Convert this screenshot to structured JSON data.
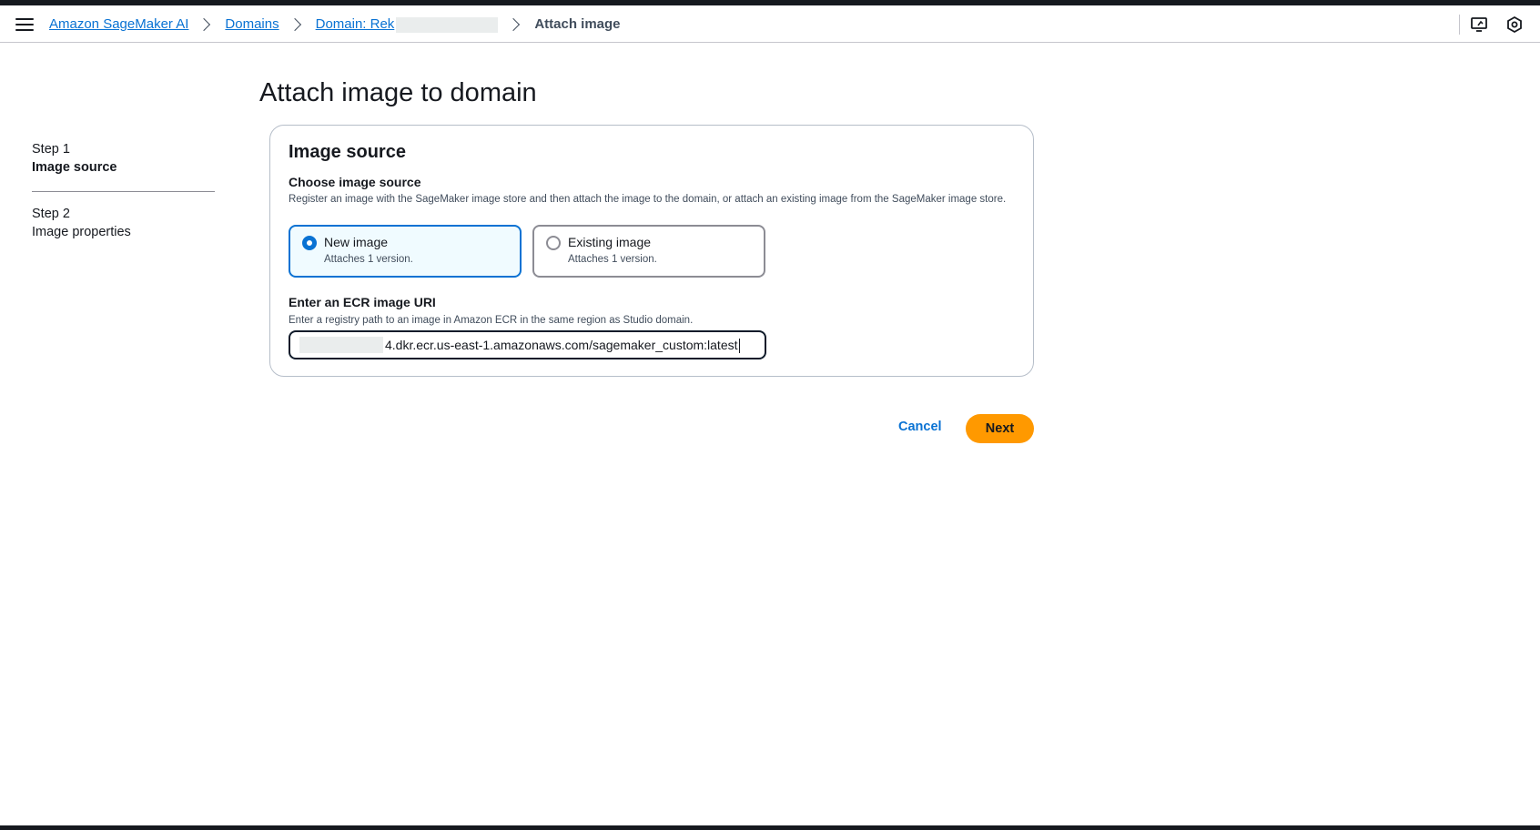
{
  "breadcrumb": {
    "items": [
      "Amazon SageMaker AI",
      "Domains",
      "Domain: Rek"
    ],
    "current": "Attach image"
  },
  "steps": [
    {
      "step": "Step 1",
      "title": "Image source",
      "active": true
    },
    {
      "step": "Step 2",
      "title": "Image properties",
      "active": false
    }
  ],
  "page": {
    "title": "Attach image to domain"
  },
  "image_source": {
    "title": "Image source",
    "choose_label": "Choose image source",
    "choose_desc": "Register an image with the SageMaker image store and then attach the image to the domain, or attach an existing image from the SageMaker image store.",
    "options": [
      {
        "label": "New image",
        "desc": "Attaches 1 version.",
        "selected": true
      },
      {
        "label": "Existing image",
        "desc": "Attaches 1 version.",
        "selected": false
      }
    ],
    "uri_label": "Enter an ECR image URI",
    "uri_desc": "Enter a registry path to an image in Amazon ECR in the same region as Studio domain.",
    "uri_value": "4.dkr.ecr.us-east-1.amazonaws.com/sagemaker_custom:latest"
  },
  "actions": {
    "cancel": "Cancel",
    "next": "Next"
  },
  "colors": {
    "link": "#0972d3",
    "primary": "#ff9900",
    "text": "#16191f"
  },
  "icons": [
    "menu-icon",
    "chevron-right-icon",
    "display-icon",
    "settings-hex-icon"
  ]
}
